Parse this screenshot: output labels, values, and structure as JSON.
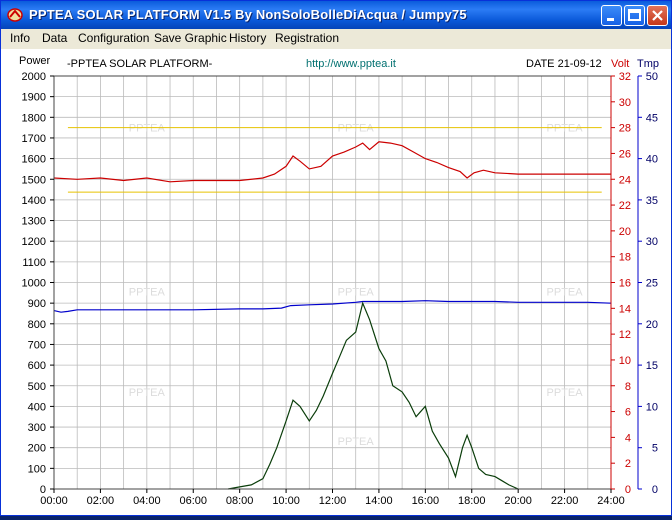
{
  "window": {
    "title": "PPTEA SOLAR PLATFORM V1.5  By NonSoloBolleDiAcqua / Jumpy75"
  },
  "menu": [
    "Info",
    "Data",
    "Configuration",
    "Save Graphic",
    "History",
    "Registration"
  ],
  "icons": {
    "app": "pptea-logo-icon",
    "minimize": "minimize-icon",
    "maximize": "maximize-icon",
    "close": "close-icon"
  },
  "chart": {
    "header_left": "-PPTEA SOLAR PLATFORM-",
    "header_center": "http://www.pptea.it",
    "header_date": "DATE 21-09-12",
    "watermark": "PPTEA",
    "colors": {
      "power": "#0a3d0a",
      "volt": "#cc0000",
      "tmp": "#0000cc",
      "threshold": "#e6c200",
      "grid": "#bbbbbb"
    }
  },
  "chart_data": {
    "type": "line",
    "x_unit": "time of day",
    "x_ticks": [
      "00:00",
      "02:00",
      "04:00",
      "06:00",
      "08:00",
      "10:00",
      "12:00",
      "14:00",
      "16:00",
      "18:00",
      "20:00",
      "22:00",
      "24:00"
    ],
    "xlim": [
      0,
      24
    ],
    "axes": {
      "power": {
        "label": "Power",
        "ylim": [
          0,
          2000
        ],
        "ticks": [
          0,
          100,
          200,
          300,
          400,
          500,
          600,
          700,
          800,
          900,
          1000,
          1100,
          1200,
          1300,
          1400,
          1500,
          1600,
          1700,
          1800,
          1900,
          2000
        ]
      },
      "volt": {
        "label": "Volt",
        "ylim": [
          0,
          32
        ],
        "ticks": [
          0,
          2,
          4,
          6,
          8,
          10,
          12,
          14,
          16,
          18,
          20,
          22,
          24,
          26,
          28,
          30,
          32
        ]
      },
      "tmp": {
        "label": "Tmp",
        "ylim": [
          0,
          50
        ],
        "ticks": [
          0,
          5,
          10,
          15,
          20,
          25,
          30,
          35,
          40,
          45,
          50
        ]
      }
    },
    "thresholds_volt": [
      28,
      23
    ],
    "series": [
      {
        "axis": "volt",
        "x": [
          0,
          1,
          2,
          3,
          4,
          5,
          6,
          7,
          8,
          9,
          9.5,
          10,
          10.3,
          10.6,
          11,
          11.5,
          12,
          12.5,
          13,
          13.3,
          13.6,
          14,
          14.5,
          15,
          15.5,
          16,
          16.5,
          17,
          17.5,
          17.8,
          18.1,
          18.5,
          19,
          20,
          21,
          22,
          23,
          24
        ],
        "y": [
          24.1,
          24.0,
          24.1,
          23.9,
          24.1,
          23.8,
          23.9,
          23.9,
          23.9,
          24.1,
          24.4,
          25.0,
          25.8,
          25.4,
          24.8,
          25.0,
          25.8,
          26.1,
          26.5,
          26.8,
          26.3,
          26.9,
          26.8,
          26.6,
          26.1,
          25.6,
          25.3,
          24.9,
          24.6,
          24.1,
          24.5,
          24.7,
          24.5,
          24.4,
          24.4,
          24.4,
          24.4,
          24.4
        ]
      },
      {
        "axis": "tmp",
        "x": [
          0,
          0.3,
          0.6,
          1,
          2,
          4,
          6,
          8,
          9,
          9.8,
          10.2,
          11,
          12,
          13,
          13.3,
          14,
          15,
          16,
          17,
          18,
          19,
          20,
          21,
          22,
          23,
          24
        ],
        "y": [
          21.6,
          21.4,
          21.5,
          21.7,
          21.7,
          21.7,
          21.7,
          21.8,
          21.8,
          21.9,
          22.2,
          22.3,
          22.4,
          22.6,
          22.7,
          22.7,
          22.7,
          22.8,
          22.7,
          22.7,
          22.7,
          22.6,
          22.6,
          22.6,
          22.6,
          22.5
        ]
      },
      {
        "axis": "power",
        "x": [
          7.5,
          8,
          8.5,
          9,
          9.3,
          9.6,
          10,
          10.3,
          10.6,
          11,
          11.3,
          11.6,
          12,
          12.3,
          12.6,
          13,
          13.3,
          13.6,
          14,
          14.3,
          14.6,
          15,
          15.3,
          15.6,
          16,
          16.3,
          16.6,
          17,
          17.3,
          17.6,
          17.8,
          18,
          18.3,
          18.6,
          19,
          19.3,
          19.6,
          20
        ],
        "y": [
          0,
          10,
          20,
          50,
          120,
          200,
          330,
          430,
          400,
          330,
          380,
          450,
          560,
          640,
          720,
          760,
          900,
          820,
          680,
          620,
          500,
          470,
          420,
          350,
          400,
          280,
          220,
          150,
          60,
          200,
          260,
          200,
          100,
          70,
          60,
          40,
          20,
          0
        ]
      }
    ]
  }
}
